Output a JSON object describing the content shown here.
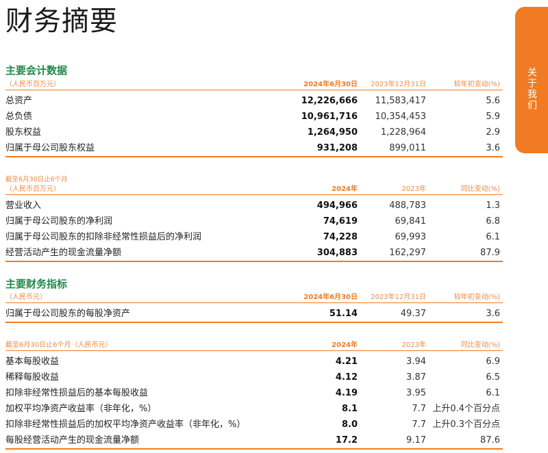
{
  "page_title": "财务摘要",
  "side_tab": "关于我们",
  "sections": [
    {
      "title": "主要会计数据"
    },
    {
      "title": "主要财务指标"
    }
  ],
  "tables": [
    {
      "note_top": "",
      "note": "（人民币百万元）",
      "headers": [
        "2024年6月30日",
        "2023年12月31日",
        "较年初变动(%)"
      ],
      "rows": [
        [
          "总资产",
          "12,226,666",
          "11,583,417",
          "5.6"
        ],
        [
          "总负债",
          "10,961,716",
          "10,354,453",
          "5.9"
        ],
        [
          "股东权益",
          "1,264,950",
          "1,228,964",
          "2.9"
        ],
        [
          "归属于母公司股东权益",
          "931,208",
          "899,011",
          "3.6"
        ]
      ]
    },
    {
      "note_top": "截至6月30日止6个月",
      "note": "（人民币百万元）",
      "headers": [
        "2024年",
        "2023年",
        "同比变动(%)"
      ],
      "rows": [
        [
          "营业收入",
          "494,966",
          "488,783",
          "1.3"
        ],
        [
          "归属于母公司股东的净利润",
          "74,619",
          "69,841",
          "6.8"
        ],
        [
          "归属于母公司股东的扣除非经常性损益后的净利润",
          "74,228",
          "69,993",
          "6.1"
        ],
        [
          "经营活动产生的现金流量净额",
          "304,883",
          "162,297",
          "87.9"
        ]
      ]
    },
    {
      "note_top": "",
      "note": "（人民币元）",
      "headers": [
        "2024年6月30日",
        "2023年12月31日",
        "较年初变动(%)"
      ],
      "rows": [
        [
          "归属于母公司股东的每股净资产",
          "51.14",
          "49.37",
          "3.6"
        ]
      ]
    },
    {
      "note_top": "",
      "note": "截至6月30日止6个月（人民币元）",
      "headers": [
        "2024年",
        "2023年",
        "同比变动(%)"
      ],
      "rows": [
        [
          "基本每股收益",
          "4.21",
          "3.94",
          "6.9"
        ],
        [
          "稀释每股收益",
          "4.12",
          "3.87",
          "6.5"
        ],
        [
          "扣除非经常性损益后的基本每股收益",
          "4.19",
          "3.95",
          "6.1"
        ],
        [
          "加权平均净资产收益率（非年化，%）",
          "8.1",
          "7.7",
          "上升0.4个百分点"
        ],
        [
          "扣除非经常性损益后的加权平均净资产收益率（非年化，%）",
          "8.0",
          "7.7",
          "上升0.3个百分点"
        ],
        [
          "每股经营活动产生的现金流量净额",
          "17.2",
          "9.17",
          "87.6"
        ]
      ]
    }
  ]
}
